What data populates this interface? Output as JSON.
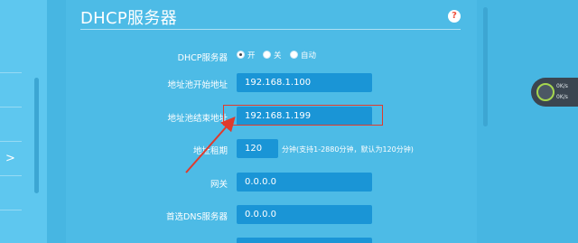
{
  "title": "DHCP服务器",
  "help": "?",
  "nav": {
    "chevron": ">"
  },
  "dhcp_server": {
    "label": "DHCP服务器",
    "options": [
      {
        "label": "开",
        "selected": true
      },
      {
        "label": "关",
        "selected": false
      },
      {
        "label": "自动",
        "selected": false
      }
    ]
  },
  "fields": {
    "pool_start": {
      "label": "地址池开始地址",
      "value": "192.168.1.100"
    },
    "pool_end": {
      "label": "地址池结束地址",
      "value": "192.168.1.199"
    },
    "lease": {
      "label": "地址租期",
      "value": "120",
      "hint": "分钟(支持1-2880分钟，默认为120分钟)"
    },
    "gateway": {
      "label": "网关",
      "value": "0.0.0.0"
    },
    "dns_primary": {
      "label": "首选DNS服务器",
      "value": "0.0.0.0"
    }
  },
  "net_widget": {
    "upload": "0K/s",
    "download": "0K/s"
  },
  "colors": {
    "background": "#47b6e2",
    "panel": "#4dbbe6",
    "field": "#1a95d6",
    "highlight": "#e03a2c",
    "help_icon": "#f0503c"
  }
}
